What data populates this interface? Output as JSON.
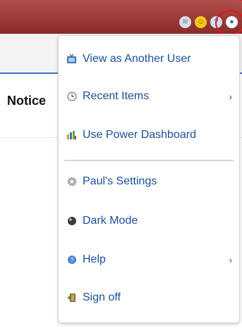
{
  "top_icons": [
    "wifi-icon",
    "smiley-icon",
    "help-icon",
    "user-icon"
  ],
  "page": {
    "heading": "Notice"
  },
  "menu": {
    "items": [
      {
        "label": "View as Another User",
        "icon": "tv-icon"
      },
      {
        "label": "Recent Items",
        "icon": "clock-icon",
        "submenu": true
      },
      {
        "label": "Use Power Dashboard",
        "icon": "dashboard-icon"
      },
      {
        "label": "Paul's Settings",
        "icon": "gear-icon"
      },
      {
        "label": "Dark Mode",
        "icon": "dark-mode-icon"
      },
      {
        "label": "Help",
        "icon": "help-icon",
        "submenu": true
      },
      {
        "label": "Sign off",
        "icon": "sign-off-icon"
      }
    ]
  },
  "colors": {
    "topbar": "#8a2b29",
    "link": "#1a4f9c",
    "annotation": "#e01818"
  }
}
